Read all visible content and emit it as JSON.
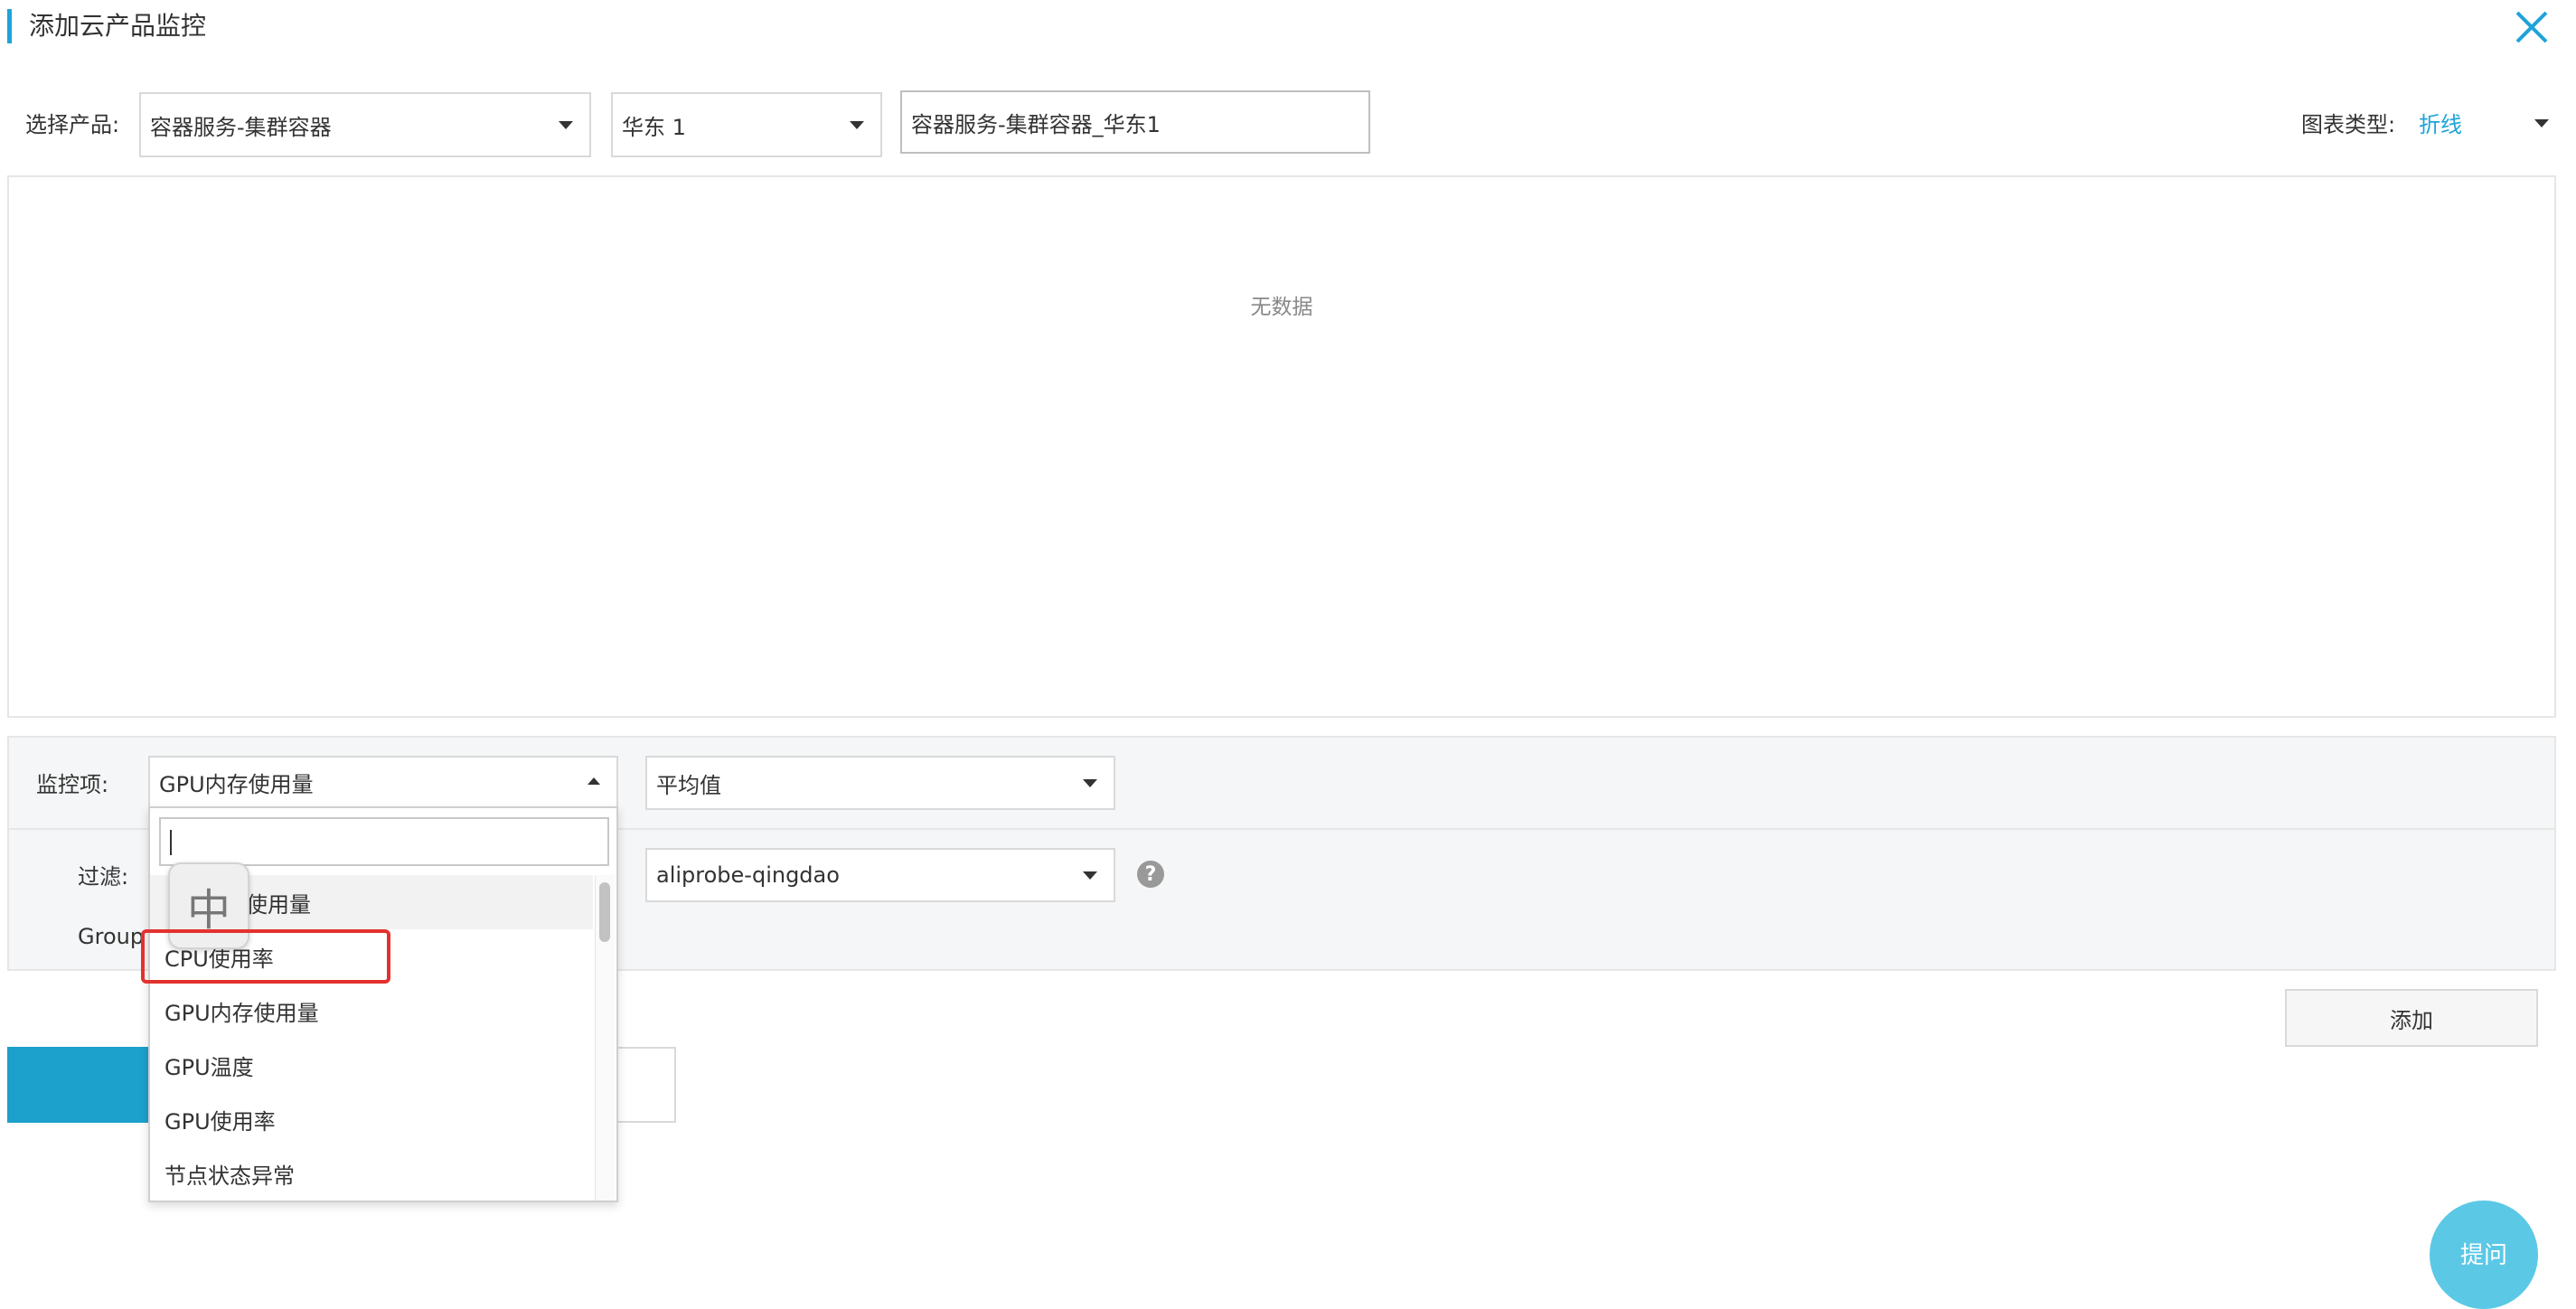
{
  "title": "添加云产品监控",
  "top": {
    "product_label": "选择产品:",
    "product_value": "容器服务-集群容器",
    "region_value": "华东 1",
    "name_input_value": "容器服务-集群容器_华东1",
    "chart_type_label": "图表类型:",
    "chart_type_value": "折线"
  },
  "chart": {
    "no_data": "无数据"
  },
  "metric": {
    "label": "监控项:",
    "value": "GPU内存使用量",
    "aggregate_value": "平均值"
  },
  "filter": {
    "label": "过滤:",
    "value": "aliprobe-qingdao",
    "group_label": "Group"
  },
  "buttons": {
    "add": "添加",
    "float_help": "提问",
    "help_mark": "?"
  },
  "dropdown": {
    "search_value": "",
    "items": [
      {
        "label": "CPU使用量",
        "visible_text": "使用量"
      },
      {
        "label": "CPU使用率"
      },
      {
        "label": "GPU内存使用量"
      },
      {
        "label": "GPU温度"
      },
      {
        "label": "GPU使用率"
      },
      {
        "label": "节点状态异常"
      }
    ],
    "ime_char": "中"
  },
  "colors": {
    "accent": "#1fa3d8",
    "primary_button": "#1ca0cc",
    "link": "#1fa3d8",
    "highlight": "#e3312d",
    "float_button": "#5bc8e6"
  }
}
